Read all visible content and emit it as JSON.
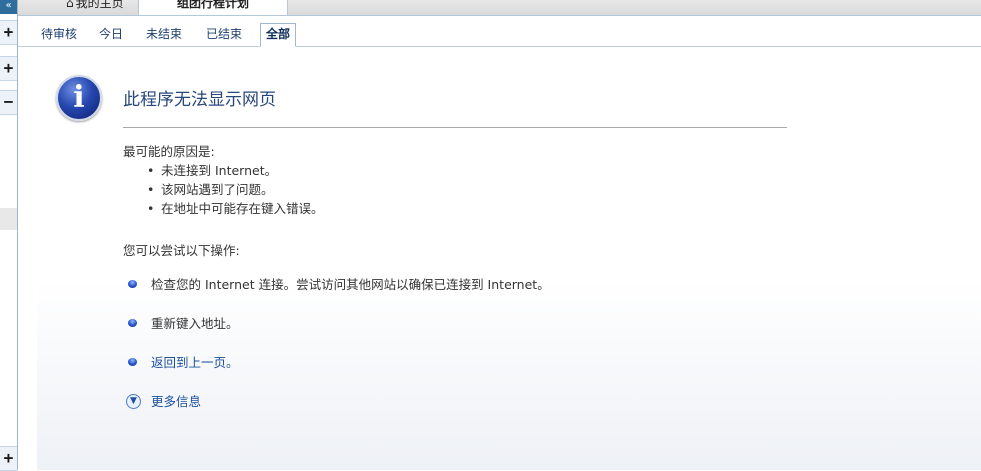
{
  "sidebar": {
    "top_symbol": "«",
    "buttons": [
      "+",
      "+",
      "−",
      "+"
    ]
  },
  "top_tabs": {
    "home_icon": "⌂",
    "home_label": "我的主页",
    "active_label": "组团行程计划"
  },
  "sub_tabs": [
    "待审核",
    "今日",
    "未结束",
    "已结束",
    "全部"
  ],
  "active_sub_tab": "全部",
  "error_page": {
    "icon": "info-icon",
    "title": "此程序无法显示网页",
    "reasons_heading": "最可能的原因是:",
    "reasons": [
      "未连接到 Internet。",
      "该网站遇到了问题。",
      "在地址中可能存在键入错误。"
    ],
    "try_heading": "您可以尝试以下操作:",
    "actions": [
      "检查您的 Internet 连接。尝试访问其他网站以确保已连接到 Internet。",
      "重新键入地址。",
      "返回到上一页。"
    ],
    "more_info": "更多信息"
  },
  "colors": {
    "title": "#28477b",
    "link": "#1b4f9c",
    "sidebar_top": "#2f6d9c"
  }
}
